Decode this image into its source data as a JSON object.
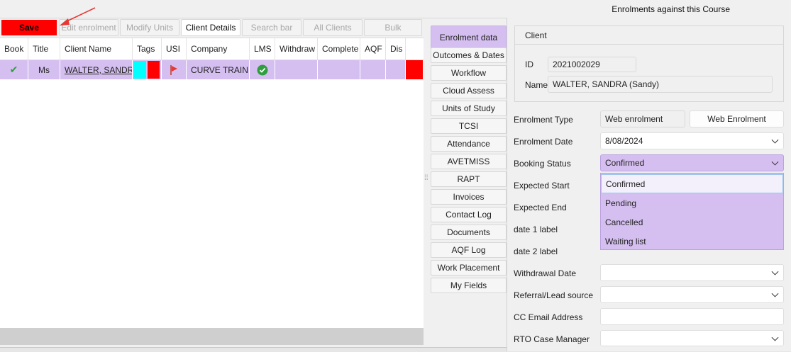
{
  "header": {
    "title": "Enrolments against this Course"
  },
  "toolbar": {
    "save": "Save",
    "edit_enrolment": "Edit enrolment",
    "modify_units": "Modify Units",
    "client_details": "Client Details",
    "search_bar": "Search bar",
    "all_clients": "All Clients",
    "bulk": "Bulk"
  },
  "grid": {
    "columns": [
      "Book",
      "Title",
      "Client Name",
      "Tags",
      "USI",
      "Company",
      "LMS",
      "Withdraw",
      "Complete",
      "AQF",
      "Dis"
    ],
    "rows": [
      {
        "book": "✔",
        "title": "Ms",
        "client_name": "WALTER, SANDRA",
        "company": "CURVE TRAININ"
      }
    ]
  },
  "tabs": [
    "Enrolment data",
    "Outcomes & Dates",
    "Workflow",
    "Cloud Assess",
    "Units of Study",
    "TCSI",
    "Attendance",
    "AVETMISS",
    "RAPT",
    "Invoices",
    "Contact Log",
    "Documents",
    "AQF Log",
    "Work Placement",
    "My Fields"
  ],
  "client": {
    "section_title": "Client",
    "id_label": "ID",
    "id_value": "2021002029",
    "name_label": "Name",
    "name_value": "WALTER, SANDRA (Sandy)"
  },
  "form": {
    "enrolment_type_label": "Enrolment Type",
    "enrolment_type_value": "Web enrolment",
    "enrolment_type_button": "Web Enrolment",
    "enrolment_date_label": "Enrolment Date",
    "enrolment_date_value": "8/08/2024",
    "booking_status_label": "Booking Status",
    "booking_status_value": "Confirmed",
    "expected_start_label": "Expected Start",
    "expected_end_label": "Expected End",
    "date1_label": "date 1 label",
    "date2_label": "date 2 label",
    "withdrawal_date_label": "Withdrawal Date",
    "referral_label": "Referral/Lead source",
    "cc_email_label": "CC Email Address",
    "rto_case_manager_label": "RTO Case Manager"
  },
  "booking_status_options": [
    "Confirmed",
    "Pending",
    "Cancelled",
    "Waiting list"
  ],
  "colors": {
    "accent_purple": "#d5bff0",
    "save_red": "#ff0000",
    "tag_cyan": "#00ffff",
    "tag_red": "#ff0000",
    "lms_green": "#2e9e3e",
    "annotation_arrow": "#e53935"
  }
}
